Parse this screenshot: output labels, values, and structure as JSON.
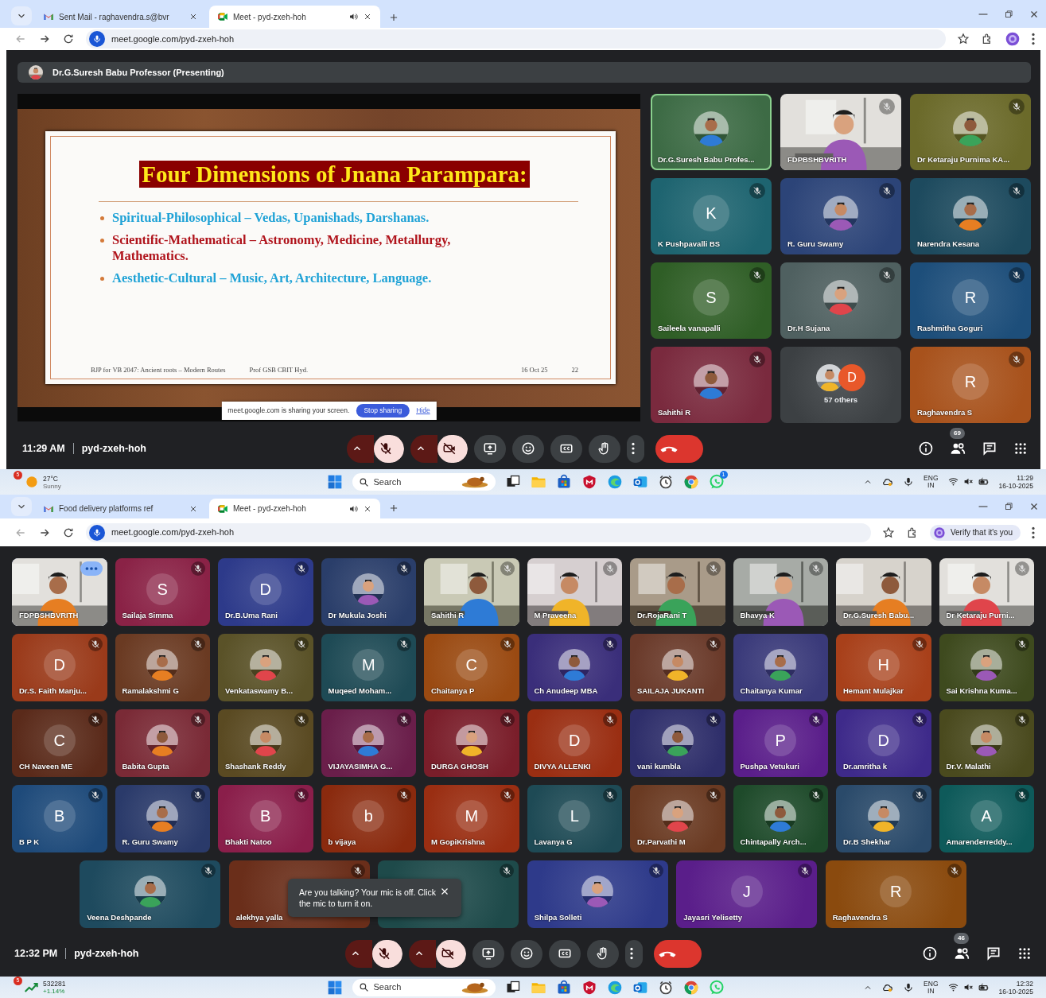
{
  "screens": [
    {
      "tabs": [
        {
          "title": "Sent Mail - raghavendra.s@bvr",
          "selected": false,
          "audio": false
        },
        {
          "title": "Meet - pyd-zxeh-hoh",
          "selected": true,
          "audio": true
        }
      ],
      "url": "meet.google.com/pyd-zxeh-hoh",
      "presenter_bar": "Dr.G.Suresh Babu Professor (Presenting)",
      "slide": {
        "title": "Four Dimensions of Jnana Parampara:",
        "bullets": [
          {
            "text": "Spiritual-Philosophical – Vedas, Upanishads, Darshanas.",
            "color": "#1fa2d6"
          },
          {
            "text": "Scientific-Mathematical – Astronomy, Medicine, Metallurgy, Mathematics.",
            "color": "#b0141c"
          },
          {
            "text": "Aesthetic-Cultural – Music, Art, Architecture, Language.",
            "color": "#1fa2d6"
          }
        ],
        "footer_left": "BJP for VB 2047: Ancient roots – Modern Routes",
        "footer_center": "Prof GSB CBIT Hyd.",
        "footer_date": "16 Oct 25",
        "footer_page": "22",
        "share_bar": {
          "message": "meet.google.com is sharing your screen.",
          "stop": "Stop sharing",
          "hide": "Hide"
        }
      },
      "tiles": [
        {
          "name": "Dr.G.Suresh Babu Profes...",
          "color": "#3d6b45",
          "muted": false,
          "highlighted": true
        },
        {
          "name": "FDPBSHBVRITH",
          "kind": "video",
          "muted": true
        },
        {
          "name": "Dr Ketaraju Purnima KA...",
          "color": "#6b6a2a",
          "muted": true
        },
        {
          "name": "K Pushpavalli BS",
          "kind": "letter",
          "letter": "K",
          "color": "#1e6470",
          "muted": true
        },
        {
          "name": "R. Guru Swamy",
          "color": "#2c4478",
          "muted": true
        },
        {
          "name": "Narendra Kesana",
          "color": "#1d4a5e",
          "muted": true
        },
        {
          "name": "Saileela vanapalli",
          "kind": "letter",
          "letter": "S",
          "color": "#2f5e26",
          "muted": true
        },
        {
          "name": "Dr.H Sujana",
          "color": "#4f6060",
          "muted": true
        },
        {
          "name": "Rashmitha Goguri",
          "kind": "letter",
          "letter": "R",
          "color": "#1d4e7a",
          "muted": true
        },
        {
          "name": "Sahithi R",
          "color": "#7a2a3e",
          "muted": true
        },
        {
          "label": "57 others",
          "kind": "others",
          "letter": "D",
          "color": "#3c4043",
          "muted": false
        },
        {
          "name": "Raghavendra S",
          "kind": "letter",
          "letter": "R",
          "color": "#a8521c",
          "muted": true
        }
      ],
      "controls": {
        "time": "11:29 AM",
        "code": "pyd-zxeh-hoh",
        "mic_on": false,
        "camera_on": false,
        "people_count": "69"
      },
      "taskbar": {
        "widget": {
          "kind": "weather",
          "badge": "5",
          "line_1": "27°C",
          "line_2": "Sunny"
        },
        "search": "Search",
        "chat_badge": "1",
        "lang": "ENG",
        "region": "IN",
        "time": "11:29",
        "date": "16-10-2025"
      }
    },
    {
      "tabs": [
        {
          "title": "Food delivery platforms ref",
          "selected": false,
          "audio": false
        },
        {
          "title": "Meet - pyd-zxeh-hoh",
          "selected": true,
          "audio": true
        }
      ],
      "url": "meet.google.com/pyd-zxeh-hoh",
      "verify_chip": "Verify that it's you",
      "tiles": [
        {
          "name": "FDPBSHBVRITH",
          "kind": "video",
          "muted": false,
          "highlighted": true,
          "more": true
        },
        {
          "name": "Sailaja Simma",
          "kind": "letter",
          "letter": "S",
          "color": "#8a2246",
          "muted": true
        },
        {
          "name": "Dr.B.Uma Rani",
          "kind": "letter",
          "letter": "D",
          "color": "#2d3a8a",
          "muted": true
        },
        {
          "name": "Dr Mukula Joshi",
          "color": "#2a3e6a",
          "muted": true
        },
        {
          "name": "Sahithi R",
          "kind": "video",
          "muted": true
        },
        {
          "name": "M Praveena",
          "kind": "video",
          "muted": true
        },
        {
          "name": "Dr.RojaRani T",
          "kind": "video",
          "muted": true
        },
        {
          "name": "Bhavya K",
          "kind": "video",
          "muted": true
        },
        {
          "name": "Dr.G.Suresh Babu...",
          "kind": "video",
          "muted": false
        },
        {
          "name": "Dr Ketaraju Purni...",
          "kind": "video",
          "muted": true
        },
        {
          "name": "Dr.S. Faith Manju...",
          "kind": "letter",
          "letter": "D",
          "color": "#9a3a1a",
          "muted": true
        },
        {
          "name": "Ramalakshmi G",
          "color": "#6a3a22",
          "muted": true
        },
        {
          "name": "Venkataswamy B...",
          "color": "#5a5228",
          "muted": true
        },
        {
          "name": "Muqeed Moham...",
          "kind": "letter",
          "letter": "M",
          "color": "#1e4a55",
          "muted": true
        },
        {
          "name": "Chaitanya P",
          "kind": "letter",
          "letter": "C",
          "color": "#9a4a12",
          "muted": true
        },
        {
          "name": "Ch Anudeep MBA",
          "color": "#3a2e7a",
          "muted": true
        },
        {
          "name": "SAILAJA JUKANTI",
          "color": "#6a3a2a",
          "muted": true
        },
        {
          "name": "Chaitanya Kumar",
          "color": "#3a3a7a",
          "muted": false
        },
        {
          "name": "Hemant Mulajkar",
          "kind": "letter",
          "letter": "H",
          "color": "#a8401a",
          "muted": true
        },
        {
          "name": "Sai Krishna Kuma...",
          "color": "#3e4a1e",
          "muted": true
        },
        {
          "name": "CH Naveen ME",
          "kind": "letter",
          "letter": "C",
          "color": "#5a2a1a",
          "muted": true
        },
        {
          "name": "Babita Gupta",
          "color": "#7a2a36",
          "muted": true
        },
        {
          "name": "Shashank Reddy",
          "color": "#5a4a22",
          "muted": true
        },
        {
          "name": "VIJAYASIMHA G...",
          "color": "#6a1e4a",
          "muted": true
        },
        {
          "name": "DURGA GHOSH",
          "color": "#7a1e2a",
          "muted": true
        },
        {
          "name": "DIVYA ALLENKI",
          "kind": "letter",
          "letter": "D",
          "color": "#9a2e12",
          "muted": true
        },
        {
          "name": "vani kumbla",
          "color": "#2e2e6a",
          "muted": true
        },
        {
          "name": "Pushpa Vetukuri",
          "kind": "letter",
          "letter": "P",
          "color": "#5a1e8a",
          "muted": true
        },
        {
          "name": "Dr.amritha k",
          "kind": "letter",
          "letter": "D",
          "color": "#3e2a8a",
          "muted": true
        },
        {
          "name": "Dr.V. Malathi",
          "color": "#4a4a1e",
          "muted": true
        },
        {
          "name": "B P K",
          "kind": "letter",
          "letter": "B",
          "color": "#1e4a7a",
          "muted": true
        },
        {
          "name": "R. Guru Swamy",
          "color": "#2a3a6a",
          "muted": true
        },
        {
          "name": "Bhakti Natoo",
          "kind": "letter",
          "letter": "B",
          "color": "#8a1e4a",
          "muted": true
        },
        {
          "name": "b vijaya",
          "kind": "letter",
          "letter": "b",
          "color": "#8a2a0e",
          "muted": true
        },
        {
          "name": "M GopiKrishna",
          "kind": "letter",
          "letter": "M",
          "color": "#9a2e12",
          "muted": true
        },
        {
          "name": "Lavanya G",
          "kind": "letter",
          "letter": "L",
          "color": "#1e4a55",
          "muted": true
        },
        {
          "name": "Dr.Parvathi M",
          "color": "#6a3a22",
          "muted": true
        },
        {
          "name": "Chintapally Arch...",
          "color": "#1e4a2a",
          "muted": true
        },
        {
          "name": "Dr.B Shekhar",
          "color": "#2a4a6a",
          "muted": true
        },
        {
          "name": "Amarenderreddy...",
          "kind": "letter",
          "letter": "A",
          "color": "#0e5a5a",
          "muted": true
        },
        {
          "name": "Veena Deshpande",
          "color": "#1e4a5e",
          "muted": true
        },
        {
          "name": "alekhya yalla",
          "kind": "blank",
          "color": "#6a2e1a",
          "muted": true
        },
        {
          "kind": "blank",
          "color": "#1e4a4a",
          "muted": true
        },
        {
          "name": "Shilpa Solleti",
          "color": "#2e3a8a",
          "muted": true
        },
        {
          "name": "Jayasri Yelisetty",
          "kind": "letter",
          "letter": "J",
          "color": "#5a1e8a",
          "muted": true
        },
        {
          "name": "Raghavendra S",
          "kind": "letter",
          "letter": "R",
          "color": "#8a4a0e",
          "muted": true
        }
      ],
      "tooltip": "Are you talking? Your mic is off. Click the mic to turn it on.",
      "controls": {
        "time": "12:32 PM",
        "code": "pyd-zxeh-hoh",
        "mic_on": false,
        "camera_on": false,
        "people_count": "46"
      },
      "taskbar": {
        "widget": {
          "kind": "stock",
          "badge": "5",
          "line_1": "532281",
          "line_2": "+1.14%"
        },
        "search": "Search",
        "lang": "ENG",
        "region": "IN",
        "time": "12:32",
        "date": "16-10-2025"
      }
    }
  ]
}
